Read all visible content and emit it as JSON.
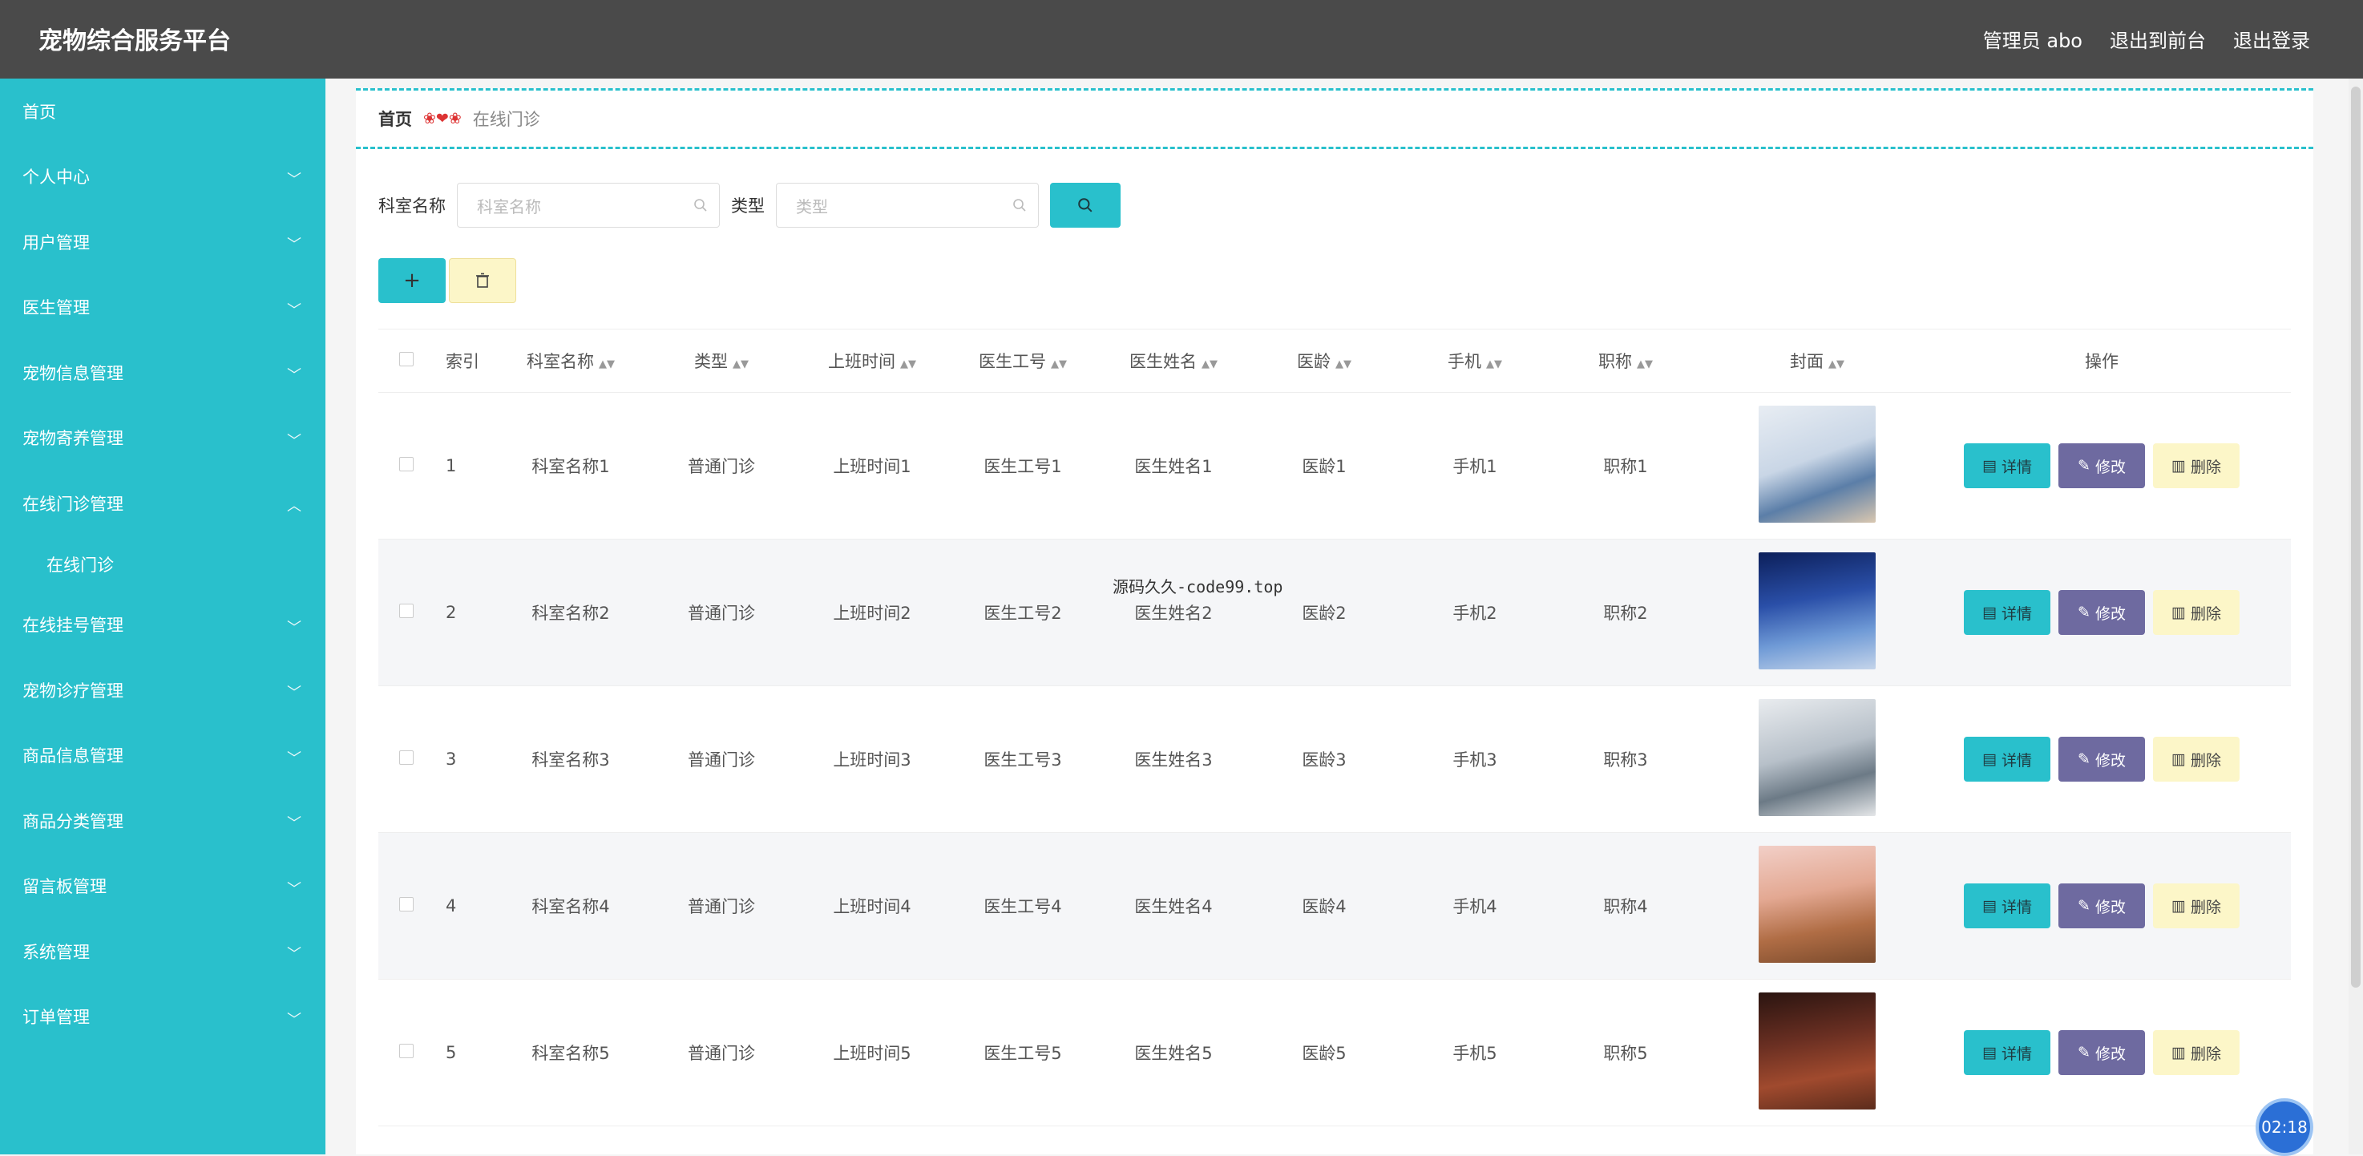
{
  "header": {
    "title": "宠物综合服务平台",
    "actions": [
      "管理员 abo",
      "退出到前台",
      "退出登录"
    ]
  },
  "sidebar": {
    "items": [
      {
        "label": "首页",
        "chevron": false
      },
      {
        "label": "个人中心",
        "chevron": true
      },
      {
        "label": "用户管理",
        "chevron": true
      },
      {
        "label": "医生管理",
        "chevron": true
      },
      {
        "label": "宠物信息管理",
        "chevron": true
      },
      {
        "label": "宠物寄养管理",
        "chevron": true
      },
      {
        "label": "在线门诊管理",
        "chevron": true,
        "expanded": true,
        "sub": "在线门诊"
      },
      {
        "label": "在线挂号管理",
        "chevron": true
      },
      {
        "label": "宠物诊疗管理",
        "chevron": true
      },
      {
        "label": "商品信息管理",
        "chevron": true
      },
      {
        "label": "商品分类管理",
        "chevron": true
      },
      {
        "label": "留言板管理",
        "chevron": true
      },
      {
        "label": "系统管理",
        "chevron": true
      },
      {
        "label": "订单管理",
        "chevron": true
      }
    ]
  },
  "breadcrumb": {
    "home": "首页",
    "sep": "❀❤❀",
    "current": "在线门诊"
  },
  "search": {
    "field1_label": "科室名称",
    "field1_placeholder": "科室名称",
    "field2_label": "类型",
    "field2_placeholder": "类型"
  },
  "table": {
    "columns": [
      "索引",
      "科室名称",
      "类型",
      "上班时间",
      "医生工号",
      "医生姓名",
      "医龄",
      "手机",
      "职称",
      "封面",
      "操作"
    ],
    "rows": [
      {
        "index": "1",
        "dept": "科室名称1",
        "type": "普通门诊",
        "time": "上班时间1",
        "docid": "医生工号1",
        "docname": "医生姓名1",
        "age": "医龄1",
        "phone": "手机1",
        "title": "职称1"
      },
      {
        "index": "2",
        "dept": "科室名称2",
        "type": "普通门诊",
        "time": "上班时间2",
        "docid": "医生工号2",
        "docname": "医生姓名2",
        "age": "医龄2",
        "phone": "手机2",
        "title": "职称2"
      },
      {
        "index": "3",
        "dept": "科室名称3",
        "type": "普通门诊",
        "time": "上班时间3",
        "docid": "医生工号3",
        "docname": "医生姓名3",
        "age": "医龄3",
        "phone": "手机3",
        "title": "职称3"
      },
      {
        "index": "4",
        "dept": "科室名称4",
        "type": "普通门诊",
        "time": "上班时间4",
        "docid": "医生工号4",
        "docname": "医生姓名4",
        "age": "医龄4",
        "phone": "手机4",
        "title": "职称4"
      },
      {
        "index": "5",
        "dept": "科室名称5",
        "type": "普通门诊",
        "time": "上班时间5",
        "docid": "医生工号5",
        "docname": "医生姓名5",
        "age": "医龄5",
        "phone": "手机5",
        "title": "职称5"
      }
    ],
    "ops": {
      "detail": "详情",
      "edit": "修改",
      "remove": "删除"
    }
  },
  "watermark": "源码久久-code99.top",
  "timer": "02:18",
  "colors": {
    "accent": "#29c0cc",
    "header": "#4a4a4a",
    "edit": "#6e6aa0",
    "delete": "#fcf6c8"
  }
}
